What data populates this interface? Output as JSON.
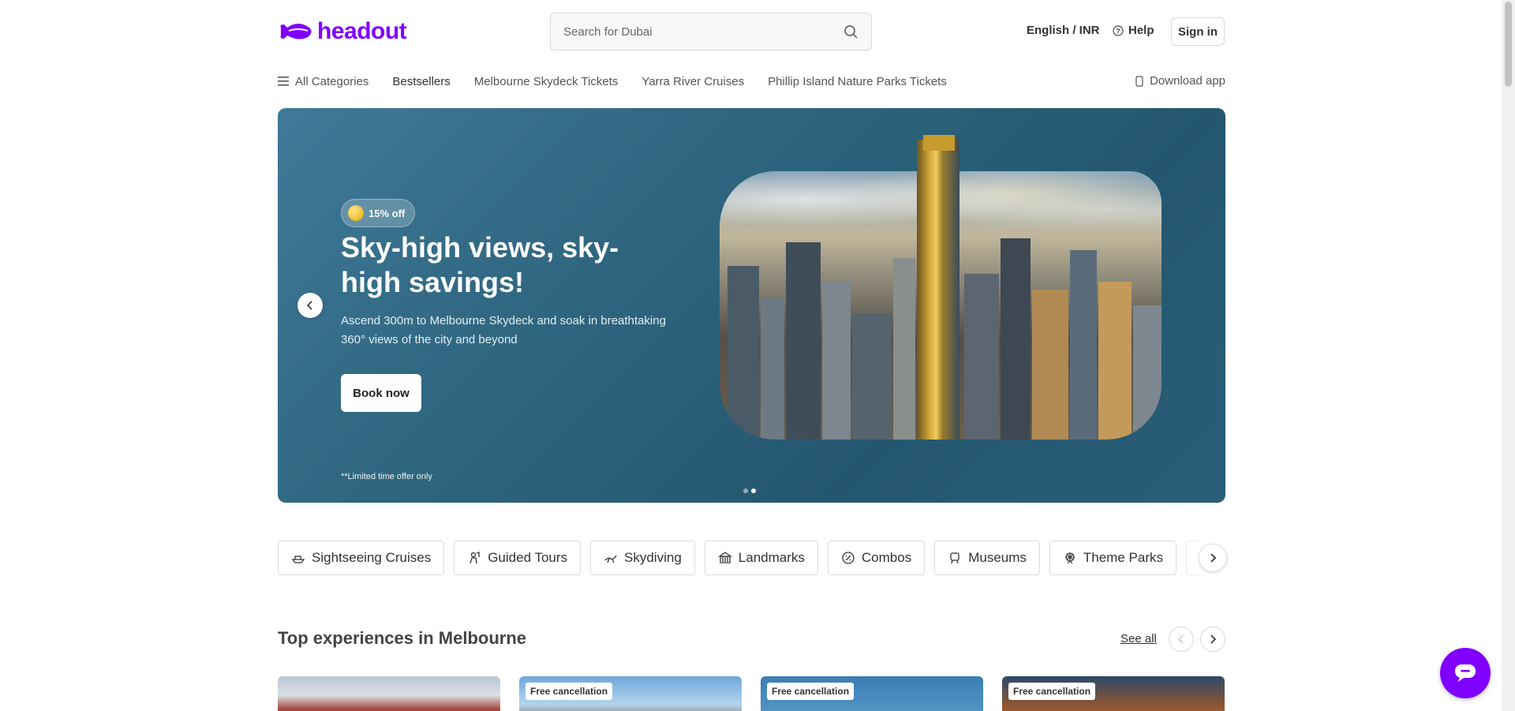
{
  "header": {
    "logo_text": "headout",
    "search_placeholder": "Search for Dubai",
    "language_currency": "English / INR",
    "help_label": "Help",
    "signin_label": "Sign in"
  },
  "nav": {
    "all_categories": "All Categories",
    "items": [
      "Bestsellers",
      "Melbourne Skydeck Tickets",
      "Yarra River Cruises",
      "Phillip Island Nature Parks Tickets"
    ],
    "download_app": "Download app"
  },
  "hero": {
    "badge": "15% off",
    "title": "Sky-high views, sky-high savings!",
    "subtitle": "Ascend 300m to Melbourne Skydeck and soak in breathtaking 360° views of the city and beyond",
    "cta_label": "Book now",
    "terms": "**Limited time offer only",
    "slide_count": 2,
    "active_slide": 2
  },
  "categories": [
    {
      "label": "Sightseeing Cruises",
      "icon": "boat-icon"
    },
    {
      "label": "Guided Tours",
      "icon": "guide-icon"
    },
    {
      "label": "Skydiving",
      "icon": "skydiving-icon"
    },
    {
      "label": "Landmarks",
      "icon": "landmark-icon"
    },
    {
      "label": "Combos",
      "icon": "combo-icon"
    },
    {
      "label": "Museums",
      "icon": "museum-icon"
    },
    {
      "label": "Theme Parks",
      "icon": "theme-park-icon"
    }
  ],
  "top_experiences": {
    "title": "Top experiences in Melbourne",
    "see_all": "See all",
    "cards": [
      {
        "badge": ""
      },
      {
        "badge": "Free cancellation"
      },
      {
        "badge": "Free cancellation"
      },
      {
        "badge": "Free cancellation"
      }
    ]
  },
  "colors": {
    "brand": "#8000ff",
    "hero_bg": "#2f6680",
    "text": "#444444"
  }
}
